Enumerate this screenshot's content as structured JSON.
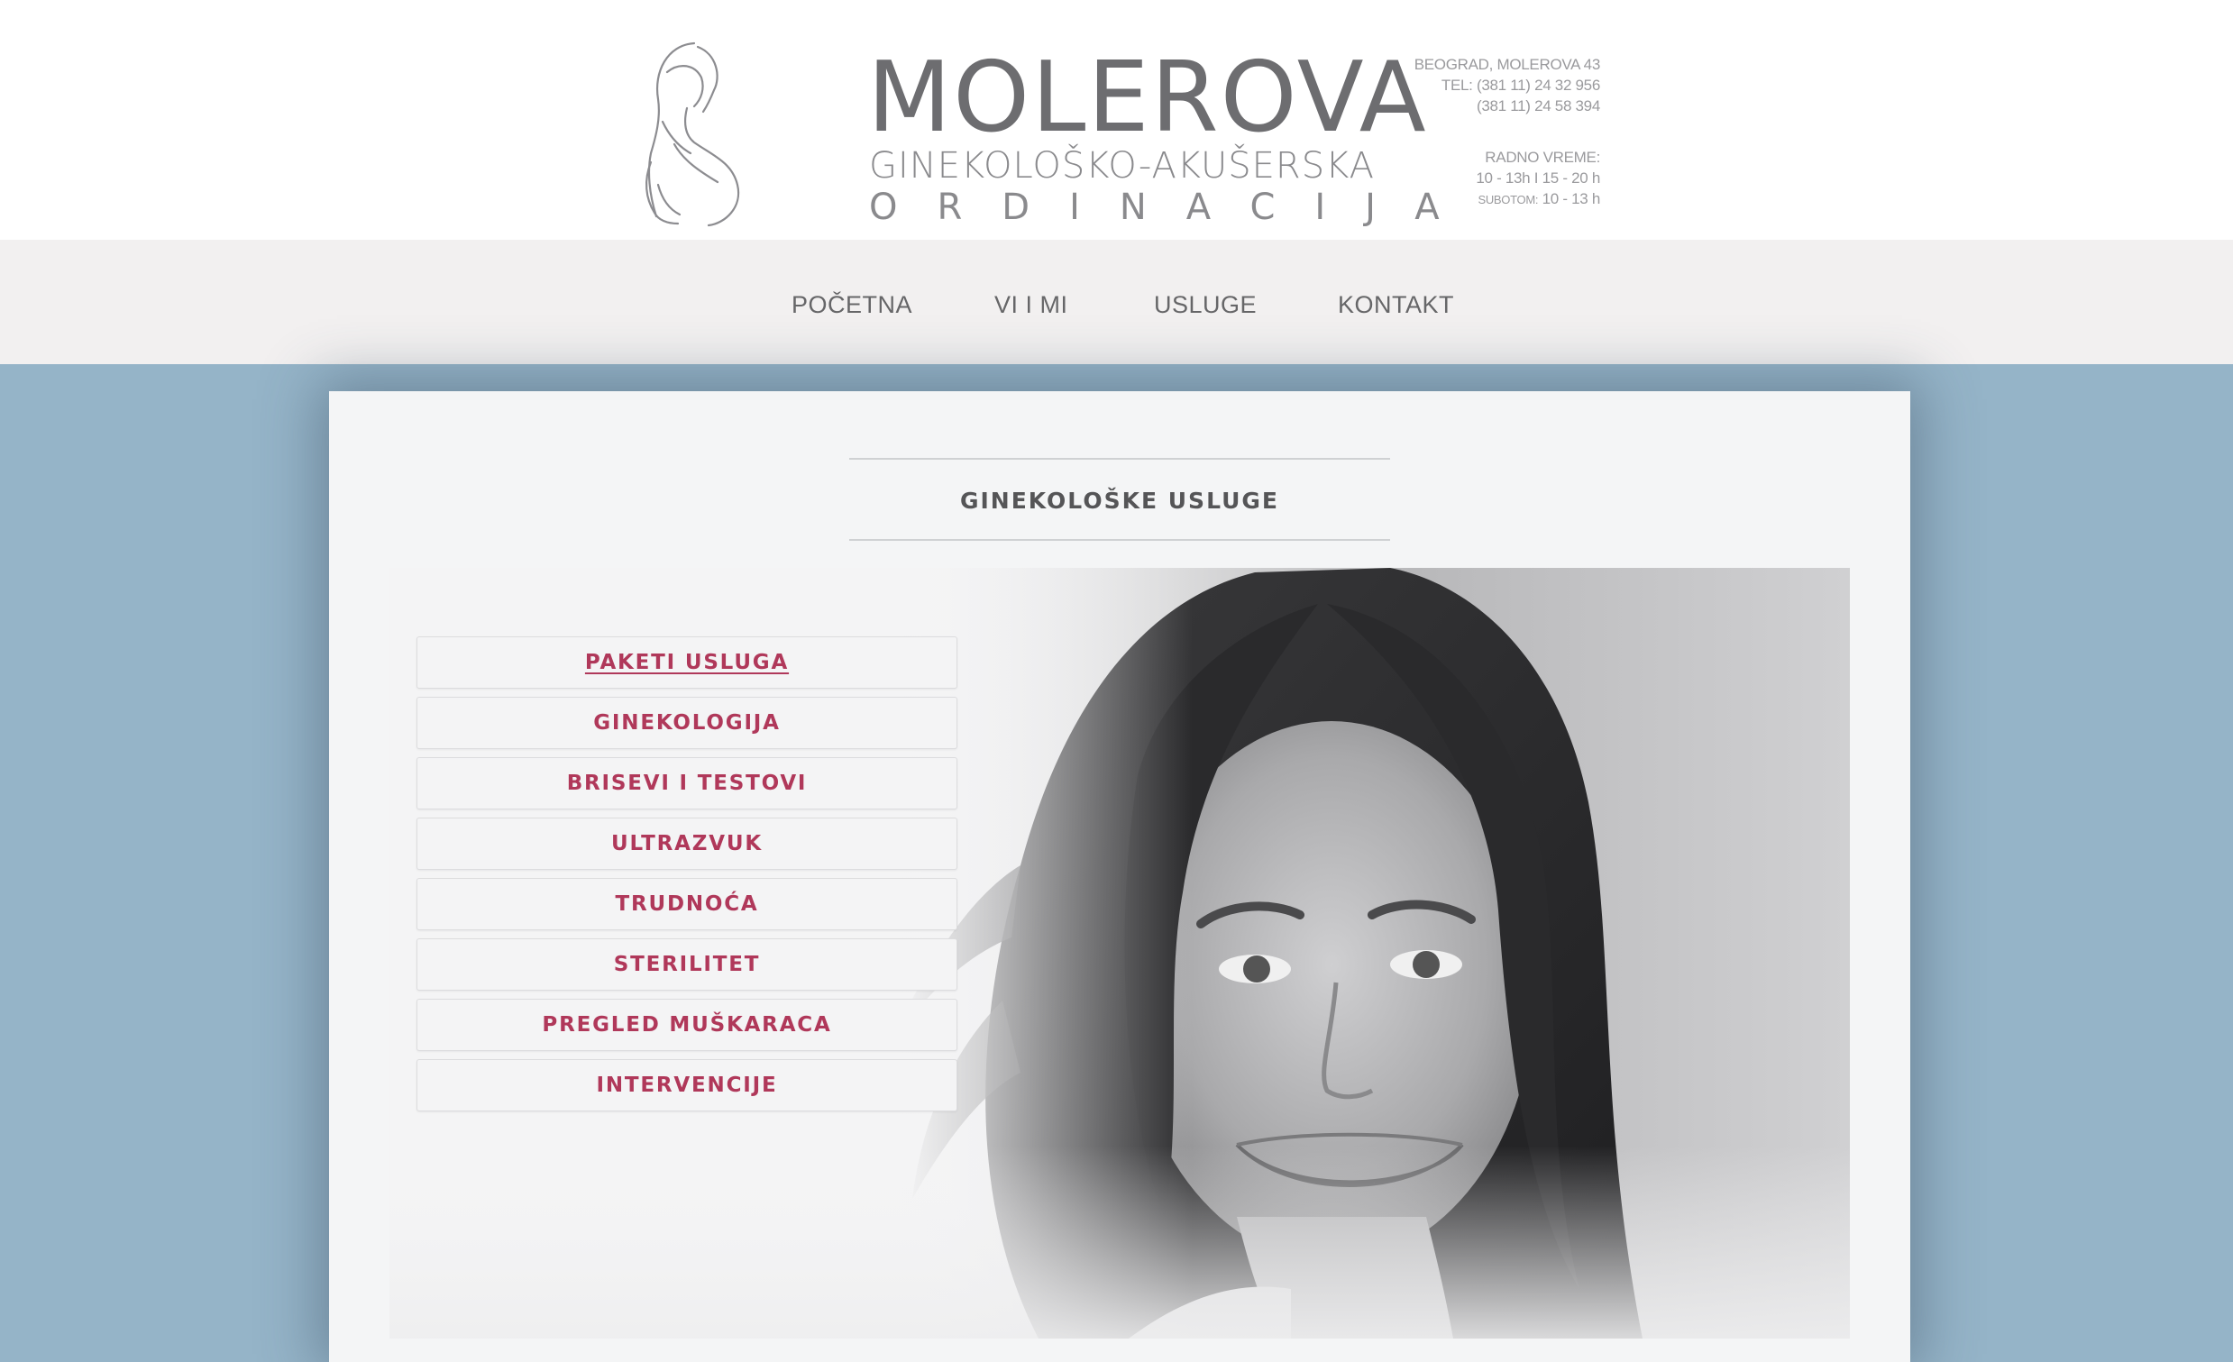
{
  "header": {
    "brand_name": "MOLEROVA",
    "brand_sub": "GINEKOLOŠKO-AKUŠERSKA",
    "brand_sub2": "ORDINACIJA",
    "contact": {
      "address": "BEOGRAD, MOLEROVA 43",
      "tel1": "TEL: (381 11) 24 32 956",
      "tel2": "(381 11) 24 58 394",
      "hours_title": "RADNO VREME:",
      "hours_week": "10 - 13h I 15 - 20 h",
      "hours_sat_label": "SUBOTOM:",
      "hours_sat": "10 - 13 h"
    }
  },
  "nav": {
    "items": [
      {
        "label": "POČETNA"
      },
      {
        "label": "VI I MI"
      },
      {
        "label": "USLUGE"
      },
      {
        "label": "KONTAKT"
      }
    ]
  },
  "main": {
    "section_title": "GINEKOLOŠKE USLUGE",
    "menu": [
      {
        "label": "PAKETI USLUGA",
        "active": true
      },
      {
        "label": "GINEKOLOGIJA"
      },
      {
        "label": "BRISEVI I TESTOVI"
      },
      {
        "label": "ULTRAZVUK"
      },
      {
        "label": "TRUDNOĆA"
      },
      {
        "label": "STERILITET"
      },
      {
        "label": "PREGLED MUŠKARACA"
      },
      {
        "label": "INTERVENCIJE"
      }
    ]
  },
  "colors": {
    "accent": "#b0385a",
    "background": "#95b4c8",
    "nav_bg": "#f2f0f0",
    "text_gray": "#6d6d70"
  }
}
